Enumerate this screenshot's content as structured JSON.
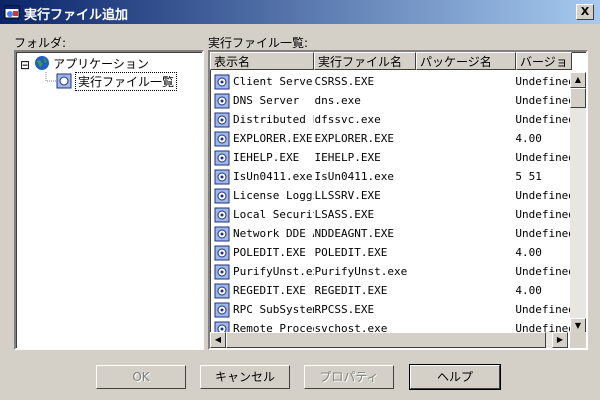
{
  "window": {
    "title": "実行ファイル追加",
    "close_label": "X"
  },
  "folder": {
    "label": "フォルダ:",
    "items": [
      {
        "label": "アプリケーション",
        "toggle": "⊟"
      },
      {
        "label": "実行ファイル一覧"
      }
    ]
  },
  "list": {
    "label": "実行ファイル一覧:",
    "columns": [
      "表示名",
      "実行ファイル名",
      "パッケージ名",
      "バージョ"
    ],
    "rows": [
      {
        "name": "Client Server",
        "exe": "CSRSS.EXE",
        "pkg": "",
        "ver": "Undefined"
      },
      {
        "name": "DNS Server",
        "exe": "dns.exe",
        "pkg": "",
        "ver": "Undefined"
      },
      {
        "name": "Distributed F",
        "exe": "dfssvc.exe",
        "pkg": "",
        "ver": "Undefined"
      },
      {
        "name": "EXPLORER.EXE",
        "exe": "EXPLORER.EXE",
        "pkg": "",
        "ver": "4.00"
      },
      {
        "name": "IEHELP.EXE",
        "exe": "IEHELP.EXE",
        "pkg": "",
        "ver": "Undefined"
      },
      {
        "name": "IsUn0411.exe",
        "exe": "IsUn0411.exe",
        "pkg": "",
        "ver": "5  51"
      },
      {
        "name": "License Loggi",
        "exe": "LLSSRV.EXE",
        "pkg": "",
        "ver": "Undefined"
      },
      {
        "name": "Local Securit",
        "exe": "LSASS.EXE",
        "pkg": "",
        "ver": "Undefined"
      },
      {
        "name": "Network DDE A",
        "exe": "NDDEAGNT.EXE",
        "pkg": "",
        "ver": "Undefined"
      },
      {
        "name": "POLEDIT.EXE",
        "exe": "POLEDIT.EXE",
        "pkg": "",
        "ver": "4.00"
      },
      {
        "name": "PurifyUnst.ex",
        "exe": "PurifyUnst.exe",
        "pkg": "",
        "ver": "Undefined"
      },
      {
        "name": "REGEDIT.EXE",
        "exe": "REGEDIT.EXE",
        "pkg": "",
        "ver": "4.00"
      },
      {
        "name": "RPC SubSystem",
        "exe": "RPCSS.EXE",
        "pkg": "",
        "ver": "Undefined"
      },
      {
        "name": "Remote Proced",
        "exe": "svchost.exe",
        "pkg": "",
        "ver": "Undefined"
      }
    ]
  },
  "buttons": {
    "ok": "OK",
    "cancel": "キャンセル",
    "properties": "プロパティ",
    "help": "ヘルプ"
  }
}
